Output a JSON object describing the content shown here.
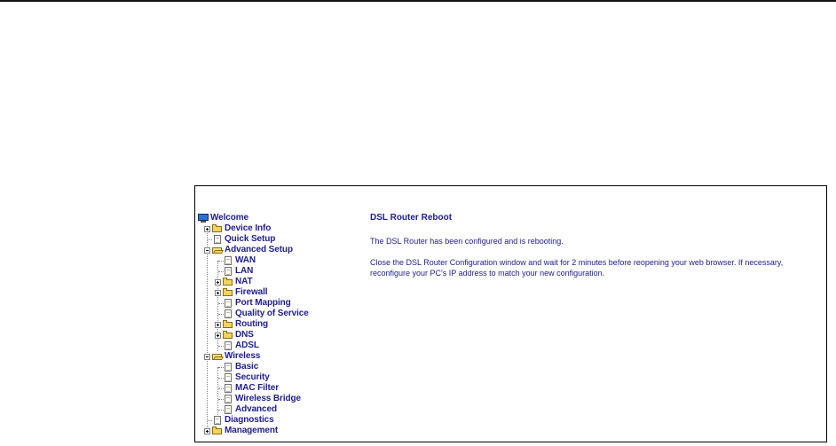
{
  "tree": {
    "items": [
      {
        "label": "Welcome",
        "icon": "monitor-icon"
      },
      {
        "label": "Device Info",
        "icon": "folder-icon",
        "expander": "plus"
      },
      {
        "label": "Quick Setup",
        "icon": "page-icon"
      },
      {
        "label": "Advanced Setup",
        "icon": "folder-open-icon",
        "expander": "minus"
      },
      {
        "label": "WAN",
        "icon": "page-icon"
      },
      {
        "label": "LAN",
        "icon": "page-icon"
      },
      {
        "label": "NAT",
        "icon": "folder-icon",
        "expander": "plus"
      },
      {
        "label": "Firewall",
        "icon": "folder-icon",
        "expander": "plus"
      },
      {
        "label": "Port Mapping",
        "icon": "page-icon"
      },
      {
        "label": "Quality of Service",
        "icon": "page-icon"
      },
      {
        "label": "Routing",
        "icon": "folder-icon",
        "expander": "plus"
      },
      {
        "label": "DNS",
        "icon": "folder-icon",
        "expander": "plus"
      },
      {
        "label": "ADSL",
        "icon": "page-icon"
      },
      {
        "label": "Wireless",
        "icon": "folder-open-icon",
        "expander": "minus"
      },
      {
        "label": "Basic",
        "icon": "page-icon"
      },
      {
        "label": "Security",
        "icon": "page-icon"
      },
      {
        "label": "MAC Filter",
        "icon": "page-icon"
      },
      {
        "label": "Wireless Bridge",
        "icon": "page-icon"
      },
      {
        "label": "Advanced",
        "icon": "page-icon"
      },
      {
        "label": "Diagnostics",
        "icon": "page-icon"
      },
      {
        "label": "Management",
        "icon": "folder-icon",
        "expander": "plus"
      }
    ]
  },
  "main": {
    "title": "DSL Router Reboot",
    "message1": "The DSL Router has been configured and is rebooting.",
    "message2": "Close the DSL Router Configuration window and wait for 2 minutes before reopening your web browser. If necessary, reconfigure your PC's IP address to match your new configuration."
  },
  "colors": {
    "link": "#1d1d8f",
    "folder": "#f4d35e"
  }
}
